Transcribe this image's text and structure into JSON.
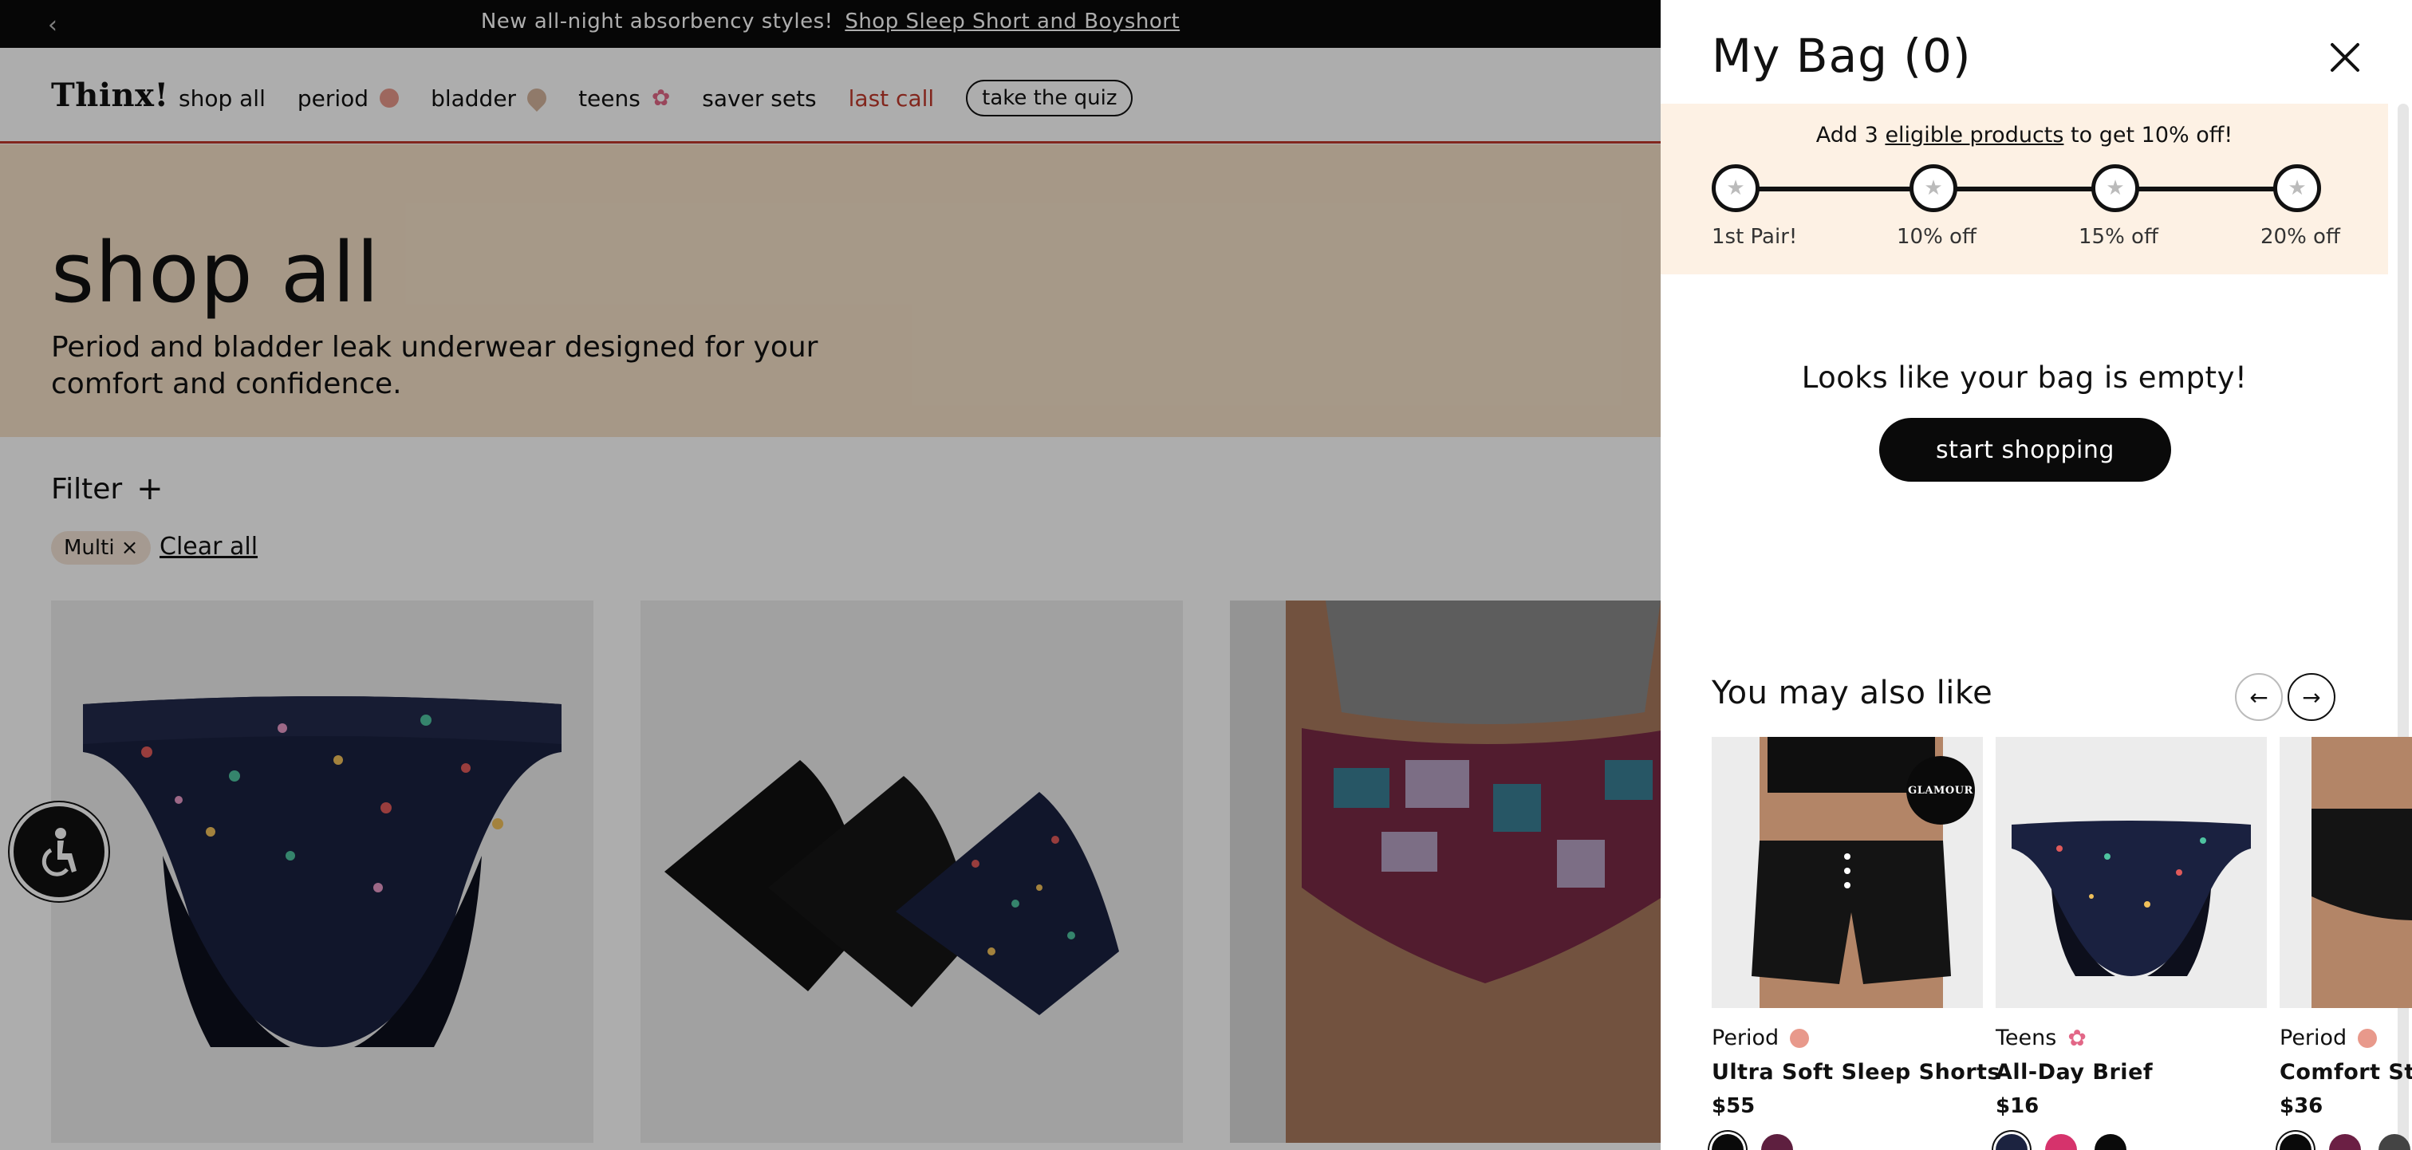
{
  "announcement": {
    "text": "New all-night absorbency styles!",
    "link": "Shop Sleep Short and Boyshort"
  },
  "nav": {
    "logo": "Thinx!",
    "links": [
      "shop all",
      "period",
      "bladder",
      "teens",
      "saver sets",
      "last call"
    ],
    "quiz": "take the quiz"
  },
  "hero": {
    "title": "shop all",
    "subtitle": "Period and bladder leak underwear designed for your comfort and confidence."
  },
  "filters": {
    "label": "Filter",
    "chip": "Multi",
    "clear": "Clear all"
  },
  "bag": {
    "title": "My Bag (0)",
    "promo": {
      "prefix": "Add 3",
      "link": "eligible products",
      "suffix": "to get 10% off!"
    },
    "tiers": [
      "1st Pair!",
      "10% off",
      "15% off",
      "20% off"
    ],
    "empty_message": "Looks like your bag is empty!",
    "cta": "start shopping"
  },
  "recommendations": {
    "title": "You may also like",
    "badge": "GLAMOUR",
    "products": [
      {
        "category": "Period",
        "name": "Ultra Soft Sleep Shorts",
        "price": "$55",
        "swatches": [
          "#0a0a0a",
          "#5e1f3f"
        ]
      },
      {
        "category": "Teens",
        "name": "All-Day Brief",
        "price": "$16",
        "swatches": [
          "#1c2340",
          "#d6336c",
          "#0a0a0a"
        ]
      },
      {
        "category": "Period",
        "name": "Comfort Stretch",
        "price": "$36",
        "swatches": [
          "#0a0a0a",
          "#6b1f44",
          "#444444"
        ]
      }
    ]
  },
  "colors": {
    "accent": "#c0392b",
    "hero_bg": "#f5e1c8",
    "promo_bg": "#fdf1e4",
    "button_bg": "#0a0a0a"
  }
}
